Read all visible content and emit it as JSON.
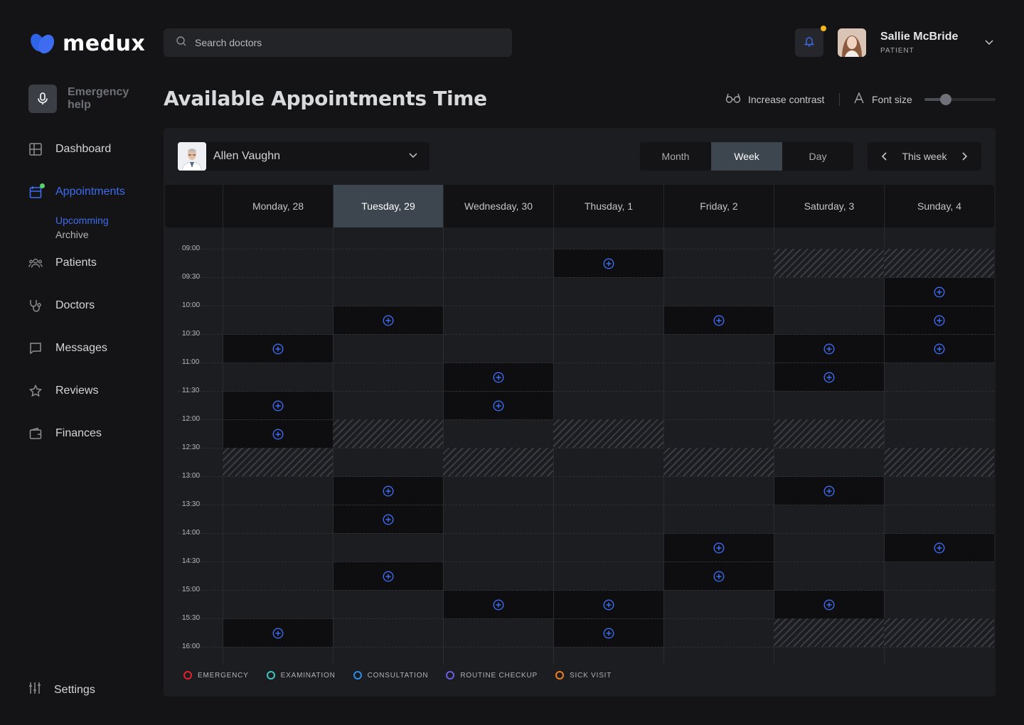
{
  "brand": {
    "name": "medux",
    "color": "#3d6cf0"
  },
  "sidebar": {
    "emergency_label": "Emergency help",
    "items": [
      {
        "label": "Dashboard",
        "icon": "grid-icon"
      },
      {
        "label": "Appointments",
        "icon": "calendar-icon",
        "active": true
      },
      {
        "label": "Patients",
        "icon": "users-icon"
      },
      {
        "label": "Doctors",
        "icon": "stethoscope-icon"
      },
      {
        "label": "Messages",
        "icon": "chat-icon"
      },
      {
        "label": "Reviews",
        "icon": "star-icon"
      },
      {
        "label": "Finances",
        "icon": "wallet-icon"
      }
    ],
    "sub_items": [
      {
        "label": "Upcomming",
        "active": true
      },
      {
        "label": "Archive"
      }
    ],
    "settings_label": "Settings"
  },
  "header": {
    "search_placeholder": "Search doctors",
    "user_name": "Sallie McBride",
    "user_role": "PATIENT"
  },
  "page": {
    "title": "Available Appointments Time",
    "contrast_label": "Increase contrast",
    "font_size_label": "Font size",
    "font_size_level": 0.3
  },
  "toolbar": {
    "doctor_name": "Allen Vaughn",
    "views": [
      "Month",
      "Week",
      "Day"
    ],
    "active_view": "Week",
    "week_label": "This week"
  },
  "calendar": {
    "days": [
      "Monday, 28",
      "Tuesday, 29",
      "Wednesday, 30",
      "Thusday, 1",
      "Friday, 2",
      "Saturday, 3",
      "Sunday, 4"
    ],
    "today_index": 1,
    "times": [
      "09:00",
      "09:30",
      "10:00",
      "10:30",
      "11:00",
      "11:30",
      "12:00",
      "12:30",
      "13:00",
      "13:30",
      "14:00",
      "14:30",
      "15:00",
      "15:30",
      "16:00"
    ],
    "available": [
      [
        0,
        "10:30"
      ],
      [
        0,
        "11:30"
      ],
      [
        0,
        "12:00"
      ],
      [
        0,
        "15:30"
      ],
      [
        1,
        "10:00"
      ],
      [
        1,
        "13:00"
      ],
      [
        1,
        "13:30"
      ],
      [
        1,
        "14:30"
      ],
      [
        2,
        "11:00"
      ],
      [
        2,
        "11:30"
      ],
      [
        2,
        "15:00"
      ],
      [
        3,
        "09:00"
      ],
      [
        3,
        "15:00"
      ],
      [
        3,
        "15:30"
      ],
      [
        4,
        "10:00"
      ],
      [
        4,
        "14:00"
      ],
      [
        4,
        "14:30"
      ],
      [
        5,
        "10:30"
      ],
      [
        5,
        "11:00"
      ],
      [
        5,
        "13:00"
      ],
      [
        5,
        "15:00"
      ],
      [
        6,
        "09:30"
      ],
      [
        6,
        "10:00"
      ],
      [
        6,
        "10:30"
      ],
      [
        6,
        "14:00"
      ]
    ],
    "unavailable": [
      [
        0,
        "12:30"
      ],
      [
        1,
        "12:00"
      ],
      [
        2,
        "12:30"
      ],
      [
        3,
        "12:00"
      ],
      [
        4,
        "12:30"
      ],
      [
        5,
        "09:00"
      ],
      [
        5,
        "12:00"
      ],
      [
        5,
        "15:30"
      ],
      [
        6,
        "09:00"
      ],
      [
        6,
        "12:30"
      ],
      [
        6,
        "15:30"
      ]
    ]
  },
  "legend": [
    {
      "label": "EMERGENCY",
      "color": "#e5212f"
    },
    {
      "label": "EXAMINATION",
      "color": "#3cc7bf"
    },
    {
      "label": "CONSULTATION",
      "color": "#2b8de8"
    },
    {
      "label": "ROUTINE CHECKUP",
      "color": "#6b5de3"
    },
    {
      "label": "SICK VISIT",
      "color": "#ef7d1f"
    }
  ]
}
